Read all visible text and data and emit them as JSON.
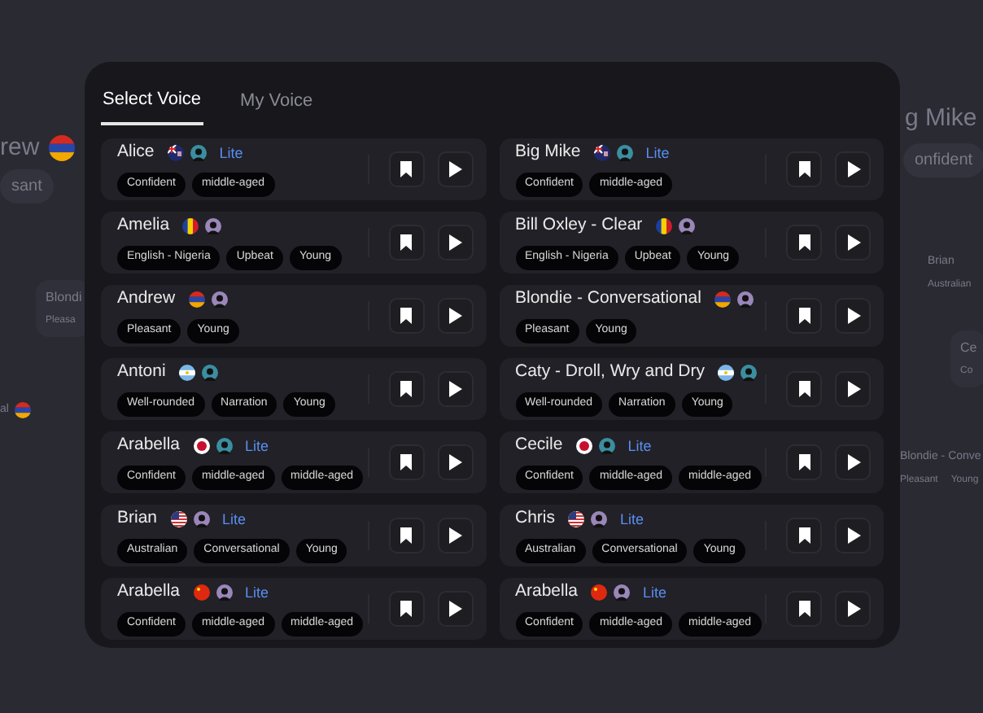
{
  "background": [
    {
      "kind": "title",
      "text": "rew",
      "flag": {
        "kind": "armenia"
      }
    },
    {
      "kind": "pill",
      "text": "sant"
    },
    {
      "kind": "card",
      "text": "Blondi",
      "sub": "Pleasa"
    },
    {
      "kind": "small",
      "text": "al",
      "flag": {
        "kind": "armenia"
      }
    },
    {
      "kind": "title",
      "text": "g Mike"
    },
    {
      "kind": "pill",
      "text": "onfident"
    },
    {
      "kind": "small",
      "text": "Brian",
      "sub": "Australian"
    },
    {
      "kind": "card",
      "text": "Ce",
      "sub": "Co"
    },
    {
      "kind": "small",
      "text": "Blondie - Conve",
      "sub": "Pleasant",
      "sub2": "Young"
    }
  ],
  "tabs": [
    {
      "label": "Select Voice",
      "selected": true
    },
    {
      "label": "My Voice",
      "selected": false
    }
  ],
  "voices": [
    {
      "name": "Alice",
      "flag": {
        "kind": "uk"
      },
      "color": "#3b8ea0",
      "badge": "Lite",
      "tags": [
        "Confident",
        "middle-aged"
      ]
    },
    {
      "name": "Big Mike",
      "flag": {
        "kind": "uk"
      },
      "color": "#3b8ea0",
      "badge": "Lite",
      "tags": [
        "Confident",
        "middle-aged"
      ]
    },
    {
      "name": "Amelia",
      "flag": {
        "kind": "chad"
      },
      "color": "#9a86b8",
      "tags": [
        "English - Nigeria",
        "Upbeat",
        "Young"
      ]
    },
    {
      "name": "Bill Oxley - Clear",
      "flag": {
        "kind": "chad"
      },
      "color": "#9a86b8",
      "tags": [
        "English - Nigeria",
        "Upbeat",
        "Young"
      ]
    },
    {
      "name": "Andrew",
      "flag": {
        "kind": "armenia"
      },
      "color": "#9a86b8",
      "tags": [
        "Pleasant",
        "Young"
      ]
    },
    {
      "name": "Blondie - Conversational",
      "flag": {
        "kind": "armenia"
      },
      "color": "#9a86b8",
      "tags": [
        "Pleasant",
        "Young"
      ]
    },
    {
      "name": "Antoni",
      "flag": {
        "kind": "argentina"
      },
      "color": "#3b8ea0",
      "tags": [
        "Well-rounded",
        "Narration",
        "Young"
      ]
    },
    {
      "name": "Caty - Droll, Wry and Dry",
      "flag": {
        "kind": "argentina"
      },
      "color": "#3b8ea0",
      "tags": [
        "Well-rounded",
        "Narration",
        "Young"
      ]
    },
    {
      "name": "Arabella",
      "flag": {
        "kind": "japan"
      },
      "color": "#3b8ea0",
      "badge": "Lite",
      "tags": [
        "Confident",
        "middle-aged",
        "middle-aged"
      ]
    },
    {
      "name": "Cecile",
      "flag": {
        "kind": "japan"
      },
      "color": "#3b8ea0",
      "badge": "Lite",
      "tags": [
        "Confident",
        "middle-aged",
        "middle-aged"
      ]
    },
    {
      "name": "Brian",
      "flag": {
        "kind": "usa"
      },
      "color": "#9a86b8",
      "badge": "Lite",
      "tags": [
        "Australian",
        "Conversational",
        "Young"
      ]
    },
    {
      "name": "Chris",
      "flag": {
        "kind": "usa"
      },
      "color": "#9a86b8",
      "badge": "Lite",
      "tags": [
        "Australian",
        "Conversational",
        "Young"
      ]
    },
    {
      "name": "Arabella",
      "flag": {
        "kind": "china"
      },
      "color": "#9a86b8",
      "badge": "Lite",
      "tags": [
        "Confident",
        "middle-aged",
        "middle-aged"
      ]
    },
    {
      "name": "Arabella",
      "flag": {
        "kind": "china"
      },
      "color": "#9a86b8",
      "badge": "Lite",
      "tags": [
        "Confident",
        "middle-aged",
        "middle-aged"
      ]
    }
  ]
}
